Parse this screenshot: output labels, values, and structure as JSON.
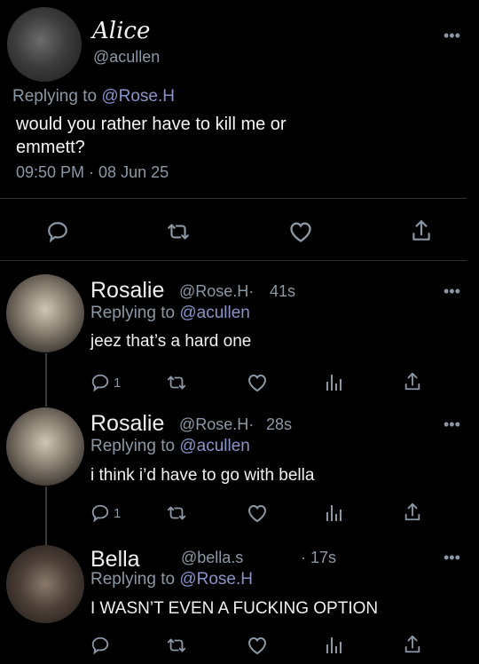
{
  "main_tweet": {
    "display_name": "Alice",
    "handle": "@acullen",
    "replying_prefix": "Replying to ",
    "replying_to": "@Rose.H",
    "text": "would you rather have to kill me or emmett?",
    "timestamp": "09:50 PM · 08 Jun 25",
    "more": "•••"
  },
  "replies": [
    {
      "display_name": "Rosalie",
      "handle": "@Rose.H·",
      "time": "41s",
      "replying_prefix": "Replying to ",
      "replying_to": "@acullen",
      "text": "jeez that’s a hard one",
      "reply_count": "1",
      "more": "•••"
    },
    {
      "display_name": "Rosalie",
      "handle": "@Rose.H·",
      "time": "28s",
      "replying_prefix": "Replying to ",
      "replying_to": "@acullen",
      "text": "i think i’d have to go with bella",
      "reply_count": "1",
      "more": "•••"
    },
    {
      "display_name": "Bella",
      "handle": "@bella.s",
      "time": "· 17s",
      "replying_prefix": "Replying to ",
      "replying_to": "@Rose.H",
      "text": "I WASN’T EVEN A FUCKING OPTION",
      "reply_count": "",
      "more": "•••"
    }
  ],
  "icons": {
    "reply": "speech-bubble-icon",
    "retweet": "retweet-icon",
    "like": "heart-icon",
    "share": "share-icon",
    "views": "bar-chart-icon",
    "more": "more-dots-icon"
  },
  "colors": {
    "background": "#000000",
    "text": "#e7e9ea",
    "muted": "#8b98a5",
    "mention": "#8a93c9",
    "divider": "#2f3336"
  }
}
